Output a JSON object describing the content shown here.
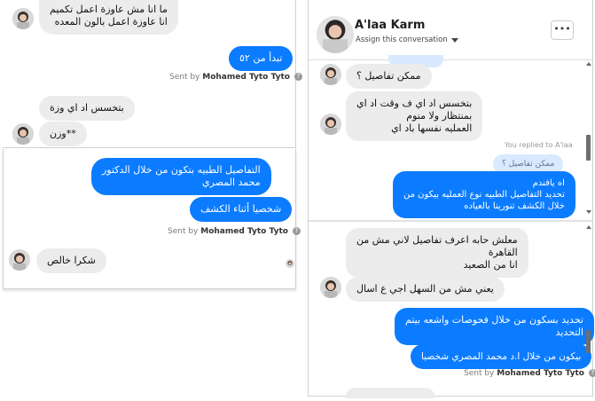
{
  "left_top": {
    "incoming_1": "ما انا مش عاوزة اعمل تكميم\nانا عاوزة اعمل بالون المعده",
    "outgoing_1": "تبدأ من ٥٢",
    "sent_prefix": "Sent by",
    "sender": "Mohamed Tyto Tyto",
    "incoming_2": "بتخسس اد اي وزة",
    "incoming_3": "**وزن"
  },
  "left_bottom": {
    "outgoing_1": "التفاصيل الطبيه بتكون من خلال الدكتور\nمحمد المصري",
    "outgoing_2": "شخصيا أثناء الكشف",
    "sent_prefix": "Sent by",
    "sender": "Mohamed Tyto Tyto",
    "incoming_1": "شكرا خالص"
  },
  "right_panel": {
    "header": {
      "name": "A'laa Karm",
      "assign_label": "Assign this conversation",
      "more_label": "•••"
    },
    "messages": {
      "incoming_1": "ممكن تفاصيل ؟",
      "incoming_2": "بتخسس اد اي  ف وقت اد اي\nبمنتظار ولا منوم\nالعمليه نفسها باد اي",
      "replied_label": "You replied to A'laa",
      "quoted": "ممكن تفاصيل ؟",
      "outgoing_1": "اه يافندم\nتحديد التفاصيل الطبيه نوع العمليه بيكون من\nخلال الكشف تنورينا بالعياده",
      "incoming_3": "معلش حابه اعرف تفاصيل لاني مش من\nالقاهرة\nانا من الصعيد",
      "incoming_4": "يعني مش من السهل اجي ع اسال",
      "outgoing_2": "تحديد بسكون من خلال فحوصات واشعه بيتم\nالتحديد",
      "outgoing_3": "بيكون من خلال ا.د محمد المصري شخصيا",
      "sent_prefix": "Sent by",
      "sender": "Mohamed Tyto Tyto"
    }
  },
  "colors": {
    "outgoing": "#0b7cff",
    "incoming": "#ececec",
    "quoted": "#d9e9ff"
  },
  "icons": [
    "avatar",
    "info-icon",
    "chevron-down-icon",
    "more-icon",
    "scroll-up-icon",
    "scroll-down-icon"
  ]
}
